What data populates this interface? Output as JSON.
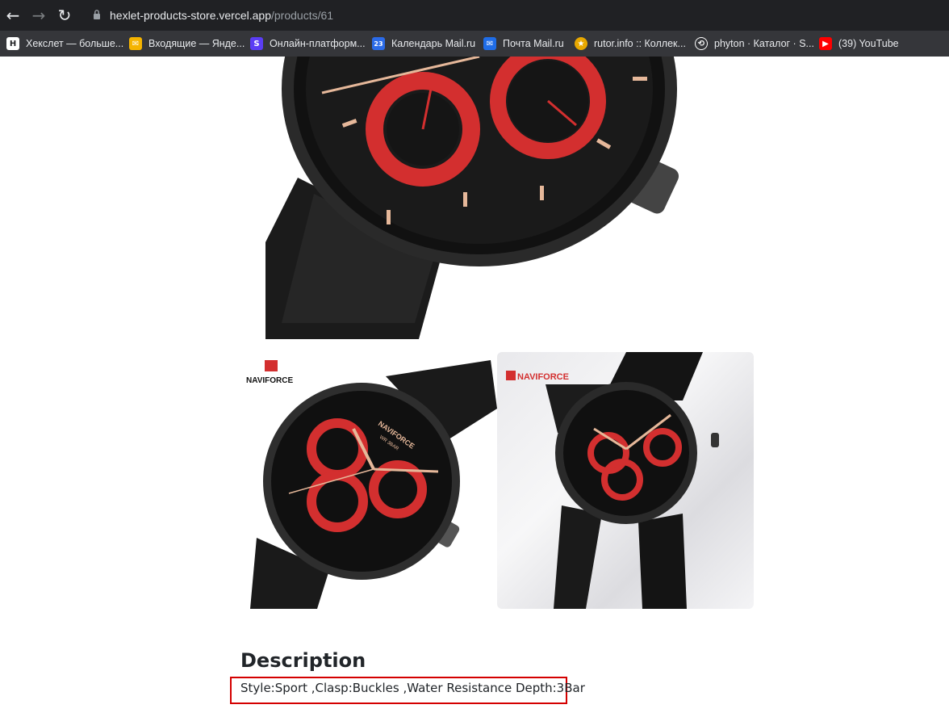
{
  "browser": {
    "url_host": "hexlet-products-store.vercel.app",
    "url_path": "/products/61",
    "bookmarks": [
      {
        "label": "Хекслет — больше...",
        "icon": "hexlet-icon",
        "color": "#ffffff"
      },
      {
        "label": "Входящие — Янде...",
        "icon": "yandex-mail-icon",
        "color": "#f5b400"
      },
      {
        "label": "Онлайн-платформ...",
        "icon": "skillbox-icon",
        "color": "#5b3df5"
      },
      {
        "label": "Календарь Mail.ru",
        "icon": "calendar-icon",
        "color": "#2b6be8"
      },
      {
        "label": "Почта Mail.ru",
        "icon": "mail-icon",
        "color": "#1f6de8"
      },
      {
        "label": "rutor.info :: Коллек...",
        "icon": "rutor-icon",
        "color": "#e8a800"
      },
      {
        "label": "phyton · Каталог · S...",
        "icon": "stepik-icon",
        "color": "#ffffff"
      },
      {
        "label": "(39) YouTube",
        "icon": "youtube-icon",
        "color": "#ff0000"
      }
    ]
  },
  "product": {
    "brand": "NAVIFORCE",
    "dial_text": "WR 3BAR",
    "description_title": "Description",
    "description_text": "Style:Sport ,Clasp:Buckles ,Water Resistance Depth:3Bar",
    "accent_color": "#d32f2f",
    "highlight_color": "#d40000"
  }
}
